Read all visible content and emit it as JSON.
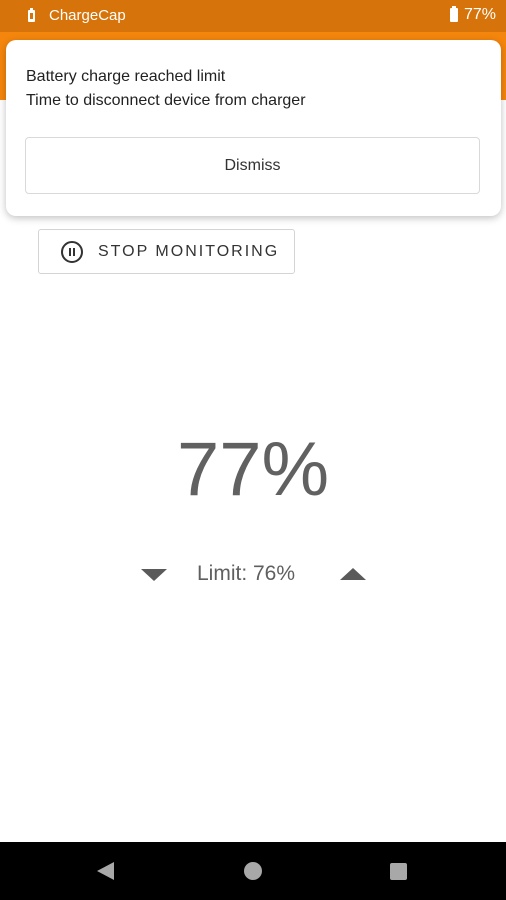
{
  "status_bar": {
    "app_name": "ChargeCap",
    "battery_percent": "77%",
    "color": "#d6730a"
  },
  "app_bar": {
    "color": "#f5860d"
  },
  "notification": {
    "title": "Battery charge reached limit",
    "body": "Time to disconnect device from charger",
    "dismiss_label": "Dismiss"
  },
  "monitoring": {
    "stop_label": "STOP MONITORING",
    "icon": "pause-circle-icon"
  },
  "battery": {
    "percent": "77%"
  },
  "limit": {
    "label": "Limit: 76%",
    "decrease_icon": "arrow-down-icon",
    "increase_icon": "arrow-up-icon"
  },
  "nav_bar": {
    "back_icon": "back-icon",
    "home_icon": "home-icon",
    "recents_icon": "recents-icon"
  }
}
